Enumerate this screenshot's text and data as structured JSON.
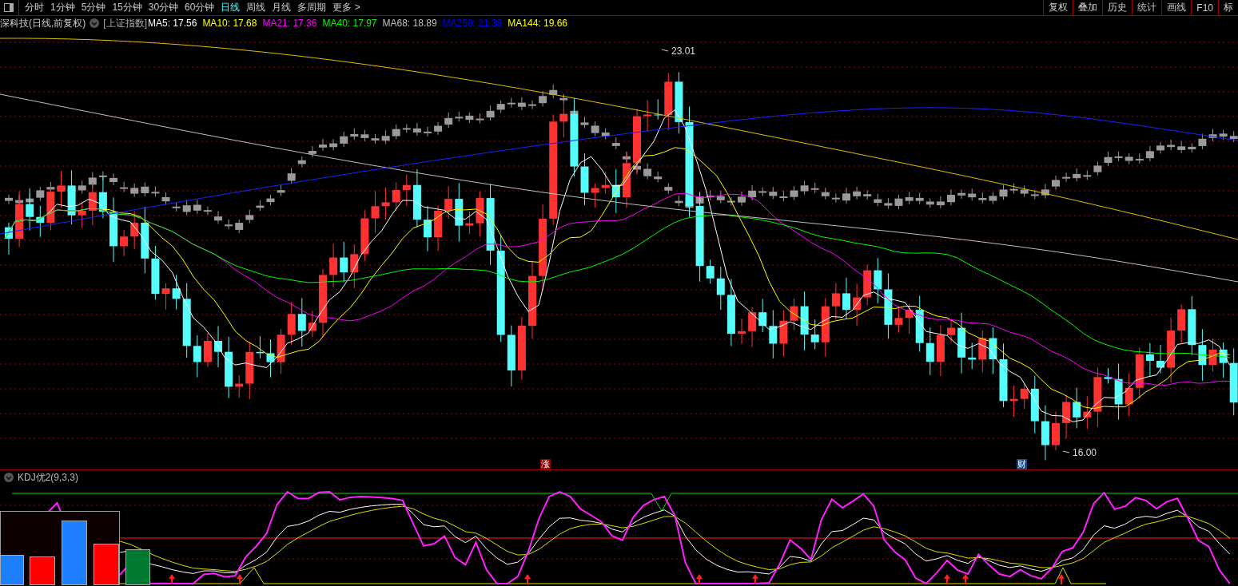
{
  "toolbar": {
    "periods": [
      {
        "label": "分时",
        "selected": false
      },
      {
        "label": "1分钟",
        "selected": false
      },
      {
        "label": "5分钟",
        "selected": false
      },
      {
        "label": "15分钟",
        "selected": false
      },
      {
        "label": "30分钟",
        "selected": false
      },
      {
        "label": "60分钟",
        "selected": false
      },
      {
        "label": "日线",
        "selected": true
      },
      {
        "label": "周线",
        "selected": false
      },
      {
        "label": "月线",
        "selected": false
      },
      {
        "label": "多周期",
        "selected": false
      },
      {
        "label": "更多 >",
        "selected": false
      }
    ],
    "tools": [
      "复权",
      "叠加",
      "历史",
      "统计",
      "画线",
      "F10",
      "标"
    ]
  },
  "info": {
    "title": "深科技(日线,前复权)",
    "index": "[上证指数]",
    "ma": [
      {
        "label": "MA5: 17.56",
        "color": "#ffffff"
      },
      {
        "label": "MA10: 17.68",
        "color": "#ffff00"
      },
      {
        "label": "MA21: 17.36",
        "color": "#ff00ff"
      },
      {
        "label": "MA40: 17.97",
        "color": "#00ff00"
      },
      {
        "label": "MA68: 18.89",
        "color": "#c0c0c0"
      },
      {
        "label": "MA250: 21.38",
        "color": "#0000ff"
      },
      {
        "label": "MA144: 19.66",
        "color": "#ffff00"
      }
    ]
  },
  "chart": {
    "high_label": "23.01",
    "low_label": "16.00",
    "markers": [
      {
        "text": "涨",
        "color": "#8b0000"
      },
      {
        "text": "财",
        "color": "#1a4a8a"
      }
    ]
  },
  "indicator": {
    "title": "KDJ优2(9,3,3)"
  }
}
